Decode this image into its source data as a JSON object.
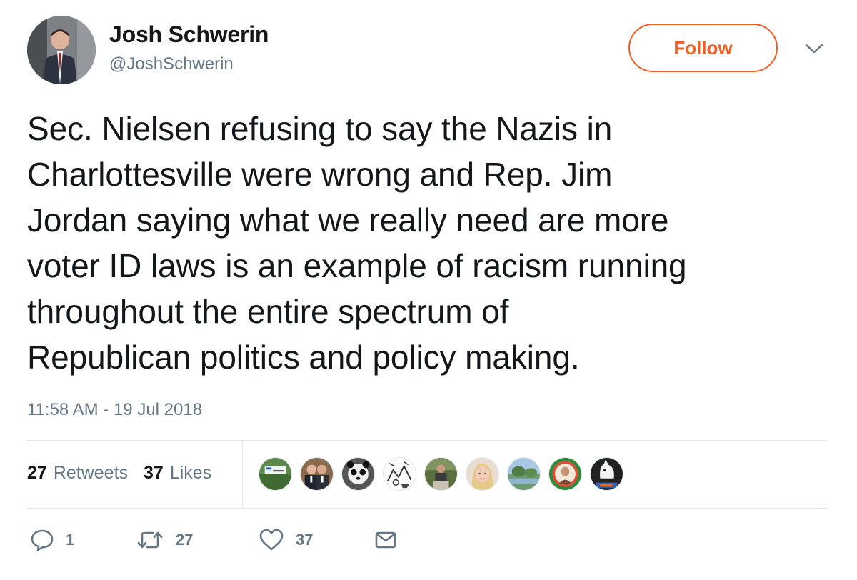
{
  "user": {
    "name": "Josh Schwerin",
    "handle": "@JoshSchwerin"
  },
  "follow_button": {
    "label": "Follow"
  },
  "tweet": {
    "lines": [
      "Sec. Nielsen refusing to say the Nazis in",
      "Charlottesville were wrong and Rep. Jim",
      "Jordan saying what we really need are more",
      "voter ID laws is an example of racism running",
      "throughout the entire spectrum of",
      "Republican politics and policy making."
    ],
    "timestamp": "11:58 AM - 19 Jul 2018"
  },
  "stats": {
    "retweets": {
      "count": "27",
      "label": "Retweets"
    },
    "likes": {
      "count": "37",
      "label": "Likes"
    }
  },
  "actions": {
    "reply": {
      "icon": "reply-icon",
      "count": "1"
    },
    "retweet": {
      "icon": "retweet-icon",
      "count": "27"
    },
    "like": {
      "icon": "heart-icon",
      "count": "37"
    },
    "message": {
      "icon": "envelope-icon"
    }
  },
  "colors": {
    "accent": "#f45d22",
    "text": "#14171a",
    "muted": "#657786",
    "divider": "#e1e8ed"
  }
}
